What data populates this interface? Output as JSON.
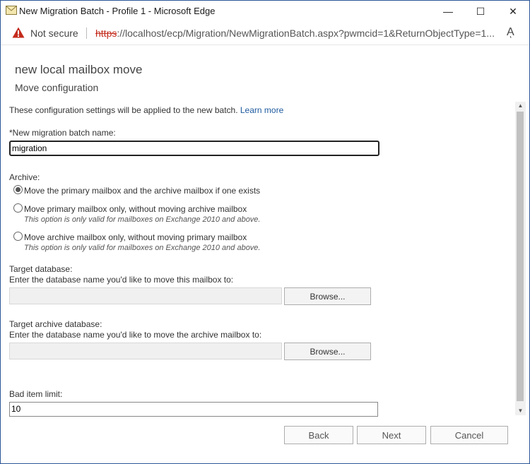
{
  "window": {
    "title": "New Migration Batch - Profile 1 - Microsoft Edge",
    "minimize_glyph": "—",
    "maximize_glyph": "☐",
    "close_glyph": "✕"
  },
  "addressbar": {
    "security_label": "Not secure",
    "url_protocol": "https",
    "url_rest": "://localhost/ecp/Migration/NewMigrationBatch.aspx?pwmcid=1&ReturnObjectType=1...",
    "read_aloud_glyph": "Aͅ"
  },
  "dialog": {
    "heading": "new local mailbox move",
    "subheading": "Move configuration",
    "intro_text": "These configuration settings will be applied to the new batch.",
    "learn_more": "Learn more",
    "batch_name_label": "*New migration batch name:",
    "batch_name_value": "migration",
    "archive_label": "Archive:",
    "archive_options": [
      {
        "label": "Move the primary mailbox and the archive mailbox if one exists",
        "note": "",
        "checked": true
      },
      {
        "label": "Move primary mailbox only, without moving archive mailbox",
        "note": "This option is only valid for mailboxes on Exchange 2010 and above.",
        "checked": false
      },
      {
        "label": "Move archive mailbox only, without moving primary mailbox",
        "note": "This option is only valid for mailboxes on Exchange 2010 and above.",
        "checked": false
      }
    ],
    "target_db_label": "Target database:",
    "target_db_hint": "Enter the database name you'd like to move this mailbox to:",
    "target_db_value": "",
    "browse_label": "Browse...",
    "target_archive_db_label": "Target archive database:",
    "target_archive_db_hint": "Enter the database name you'd like to move the archive mailbox to:",
    "target_archive_db_value": "",
    "bad_item_label": "Bad item limit:",
    "bad_item_value": "10"
  },
  "footer": {
    "back_label": "Back",
    "next_label": "Next",
    "cancel_label": "Cancel"
  },
  "scrollbar": {
    "up_glyph": "▲",
    "down_glyph": "▼"
  },
  "colors": {
    "link": "#1e5a9e",
    "warning": "#c42b1c"
  }
}
